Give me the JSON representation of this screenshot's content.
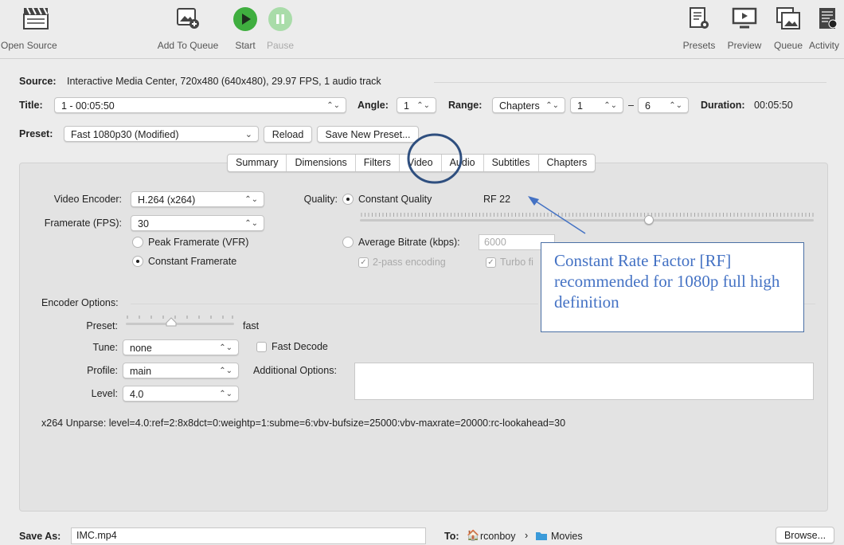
{
  "toolbar": {
    "open_source": "Open Source",
    "add_to_queue": "Add To Queue",
    "start": "Start",
    "pause": "Pause",
    "presets": "Presets",
    "preview": "Preview",
    "queue": "Queue",
    "activity": "Activity"
  },
  "source": {
    "label": "Source:",
    "value": "Interactive Media Center, 720x480 (640x480), 29.97 FPS, 1 audio track"
  },
  "title": {
    "label": "Title:",
    "value": "1 - 00:05:50"
  },
  "angle": {
    "label": "Angle:",
    "value": "1"
  },
  "range": {
    "label": "Range:",
    "mode": "Chapters",
    "from": "1",
    "dash": "–",
    "to": "6"
  },
  "duration": {
    "label": "Duration:",
    "value": "00:05:50"
  },
  "preset": {
    "label": "Preset:",
    "value": "Fast 1080p30 (Modified)",
    "reload": "Reload",
    "save_new": "Save New Preset..."
  },
  "tabs": [
    "Summary",
    "Dimensions",
    "Filters",
    "Video",
    "Audio",
    "Subtitles",
    "Chapters"
  ],
  "video": {
    "encoder_label": "Video Encoder:",
    "encoder_value": "H.264 (x264)",
    "framerate_label": "Framerate (FPS):",
    "framerate_value": "30",
    "peak_vfr": "Peak Framerate (VFR)",
    "constant_fr": "Constant Framerate",
    "quality_label": "Quality:",
    "constant_quality": "Constant Quality",
    "rf_value": "RF  22",
    "rf_fraction": 0.64,
    "avg_bitrate": "Average Bitrate (kbps):",
    "bitrate_value": "6000",
    "two_pass": "2-pass encoding",
    "turbo": "Turbo fi"
  },
  "encoder_options": {
    "label": "Encoder Options:",
    "preset_label": "Preset:",
    "preset_value": "fast",
    "tune_label": "Tune:",
    "tune_value": "none",
    "fast_decode": "Fast Decode",
    "profile_label": "Profile:",
    "profile_value": "main",
    "additional_label": "Additional Options:",
    "level_label": "Level:",
    "level_value": "4.0",
    "unparse": "x264 Unparse: level=4.0:ref=2:8x8dct=0:weightp=1:subme=6:vbv-bufsize=25000:vbv-maxrate=20000:rc-lookahead=30"
  },
  "annotation": {
    "text": "Constant Rate Factor [RF] recommended for 1080p full high definition"
  },
  "save": {
    "label": "Save As:",
    "value": "IMC.mp4",
    "to_label": "To:",
    "user": "rconboy",
    "sep": "›",
    "folder": "Movies",
    "browse": "Browse..."
  },
  "colors": {
    "start_green": "#3fae3f",
    "pause_green": "#a9dca9",
    "callout_blue": "#4472c4",
    "circle_blue": "#2f4f7f"
  }
}
